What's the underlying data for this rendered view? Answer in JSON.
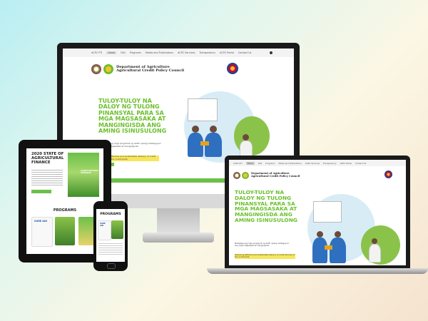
{
  "site": {
    "nav_items": [
      "ACPC PTI",
      "Home",
      "FAQ",
      "Programs",
      "Media and Publications",
      "ACPC Services",
      "Transparency",
      "ACPC Portal",
      "Contact Us"
    ],
    "org_line1": "Department of Agriculture",
    "org_line2": "Agricultural Credit Policy Council",
    "hero_title": "TULOY-TULOY NA DALOY NG TULONG PINANSYAL PARA SA MGA MAGSASAKA AT MANGINGISDA ANG AMING ISINUSULONG",
    "hero_body": "Mahalaga ang mga programa ng ACPC upang maitaguyod ang mga magsasaka at mangingisda.",
    "hero_highlight": "Delivering effective and sustainable delivery of credit services to the countryside"
  },
  "tablet": {
    "report_title": "2020 STATE OF AGRICULTURAL FINANCE",
    "report_cover_text": "AGRICULTURAL FINANCE",
    "programs_heading": "PROGRAMS",
    "program_name": "SURE AID"
  },
  "phone": {
    "programs_heading": "PROGRAMS",
    "program_name": "SURE AID"
  },
  "colors": {
    "accent_green": "#6bbf2c",
    "bar_green": "#6cc04a",
    "highlight_yellow": "#f7e65b",
    "shirt_blue": "#2e6fbf"
  }
}
